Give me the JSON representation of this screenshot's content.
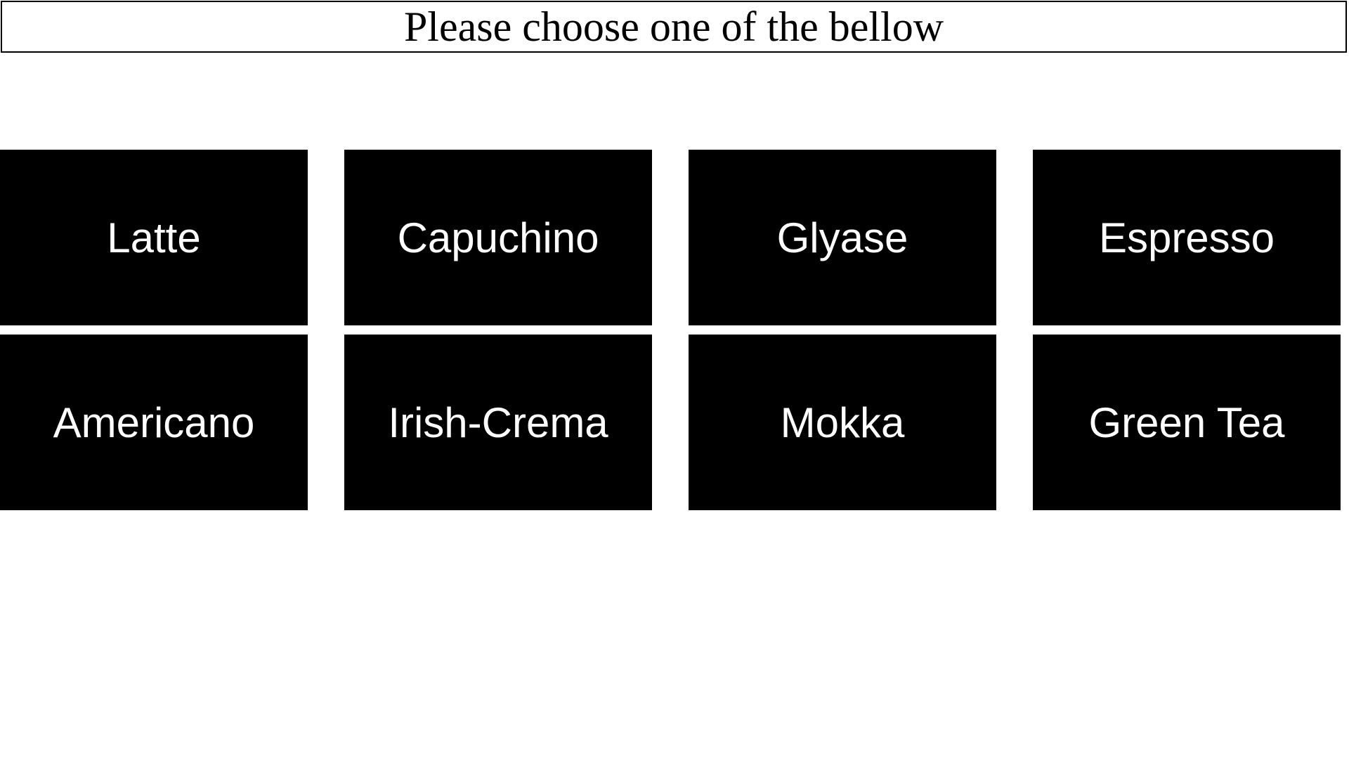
{
  "header": {
    "title": "Please choose one of the bellow"
  },
  "menu": {
    "items": [
      {
        "label": "Latte"
      },
      {
        "label": "Capuchino"
      },
      {
        "label": "Glyase"
      },
      {
        "label": "Espresso"
      },
      {
        "label": "Americano"
      },
      {
        "label": "Irish-Crema"
      },
      {
        "label": "Mokka"
      },
      {
        "label": "Green Tea"
      }
    ]
  },
  "colors": {
    "tile_background": "#000000",
    "tile_text": "#ffffff",
    "page_background": "#ffffff"
  }
}
